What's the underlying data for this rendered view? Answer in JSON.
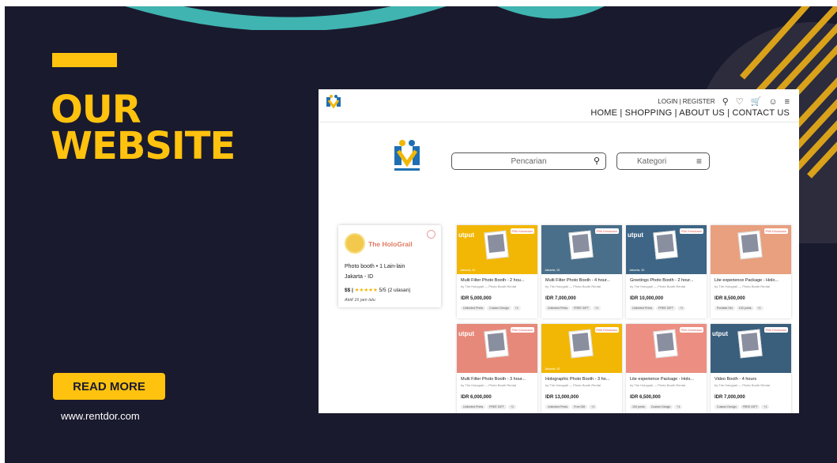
{
  "slide": {
    "headline_line1": "OUR",
    "headline_line2": "WEBSITE",
    "read_more_label": "READ MORE",
    "url": "www.rentdor.com",
    "colors": {
      "background": "#1a1a2e",
      "accent": "#ffc20e",
      "teal": "#3fb4b0"
    }
  },
  "website": {
    "top_links": "LOGIN | REGISTER",
    "top_icons": [
      "search-icon",
      "heart-icon",
      "cart-icon",
      "user-icon",
      "menu-icon"
    ],
    "nav": "HOME | SHOPPING | ABOUT US | CONTACT US",
    "search_placeholder": "Pencarian",
    "category_label": "Kategori",
    "vendor": {
      "name": "The HoloGrail",
      "line1": "Photo booth • 1 Lain-lain",
      "line2": "Jakarta -  ID",
      "price_level": "$$ |",
      "stars": "★★★★★",
      "rating": "5/5 (2 ulasan)",
      "active": "Aktif 16 jam lalu"
    },
    "cards": [
      {
        "title": "Multi Filter Photo Booth - 2 hou...",
        "by": "by The Holograil — Photo Booth Rental",
        "price": "IDR 5,000,000",
        "chips": [
          "Unlimited Prints",
          "Custom Design",
          "+1"
        ],
        "loc": "Jakarta, ID",
        "tag": "Pilih Kesukaan",
        "out": "utput",
        "color": "#f2b705"
      },
      {
        "title": "Multi Filter Photo Booth - 4 hour...",
        "by": "by The Holograil — Photo Booth Rental",
        "price": "IDR 7,000,000",
        "chips": [
          "Unlimited Prints",
          "FREE GIFT",
          "+1"
        ],
        "loc": "Jakarta, ID",
        "tag": "Pilih Kesukaan",
        "out": "",
        "color": "#4a6f8a"
      },
      {
        "title": "Greetings Photo Booth - 2 hour...",
        "by": "by The Holograil — Photo Booth Rental",
        "price": "IDR 10,000,000",
        "chips": [
          "Unlimited Prints",
          "FREE GIFT",
          "+1"
        ],
        "loc": "Jakarta, ID",
        "tag": "Pilih Kesukaan",
        "out": "utput",
        "color": "#3e6585"
      },
      {
        "title": "Lite experience Package - Holo...",
        "by": "by The Holograil — Photo Booth Rental",
        "price": "IDR 8,500,000",
        "chips": [
          "Portable Set",
          "100 prints",
          "+1"
        ],
        "loc": "",
        "tag": "Pilih Kesukaan",
        "out": "",
        "color": "#e8a07f"
      },
      {
        "title": "Multi Filter Photo Booth - 3 hour...",
        "by": "by The Holograil — Photo Booth Rental",
        "price": "IDR 6,000,000",
        "chips": [
          "Unlimited Prints",
          "FREE GIFT",
          "+1"
        ],
        "loc": "",
        "tag": "Pilih Kesukaan",
        "out": "utput",
        "color": "#e7897a"
      },
      {
        "title": "Holographic Photo Booth - 3 ho...",
        "by": "by The Holograil — Photo Booth Rental",
        "price": "IDR 13,000,000",
        "chips": [
          "Unlimited Prints",
          "Free Gift",
          "+1"
        ],
        "loc": "Jakarta, ID",
        "tag": "Pilih Kesukaan",
        "out": "",
        "color": "#f2b705"
      },
      {
        "title": "Lite experience Package - Holo...",
        "by": "by The Holograil — Photo Booth Rental",
        "price": "IDR 6,500,000",
        "chips": [
          "100 prints",
          "Custom Design",
          "+1"
        ],
        "loc": "",
        "tag": "Pilih Kesukaan",
        "out": "",
        "color": "#ec8f82"
      },
      {
        "title": "Video Booth - 4 hours",
        "by": "by The Holograil — Photo Booth Rental",
        "price": "IDR 7,000,000",
        "chips": [
          "Custom Design",
          "FREE GIFT",
          "+1"
        ],
        "loc": "",
        "tag": "Pilih Kesukaan",
        "out": "utput",
        "color": "#3a5f7d"
      }
    ]
  }
}
